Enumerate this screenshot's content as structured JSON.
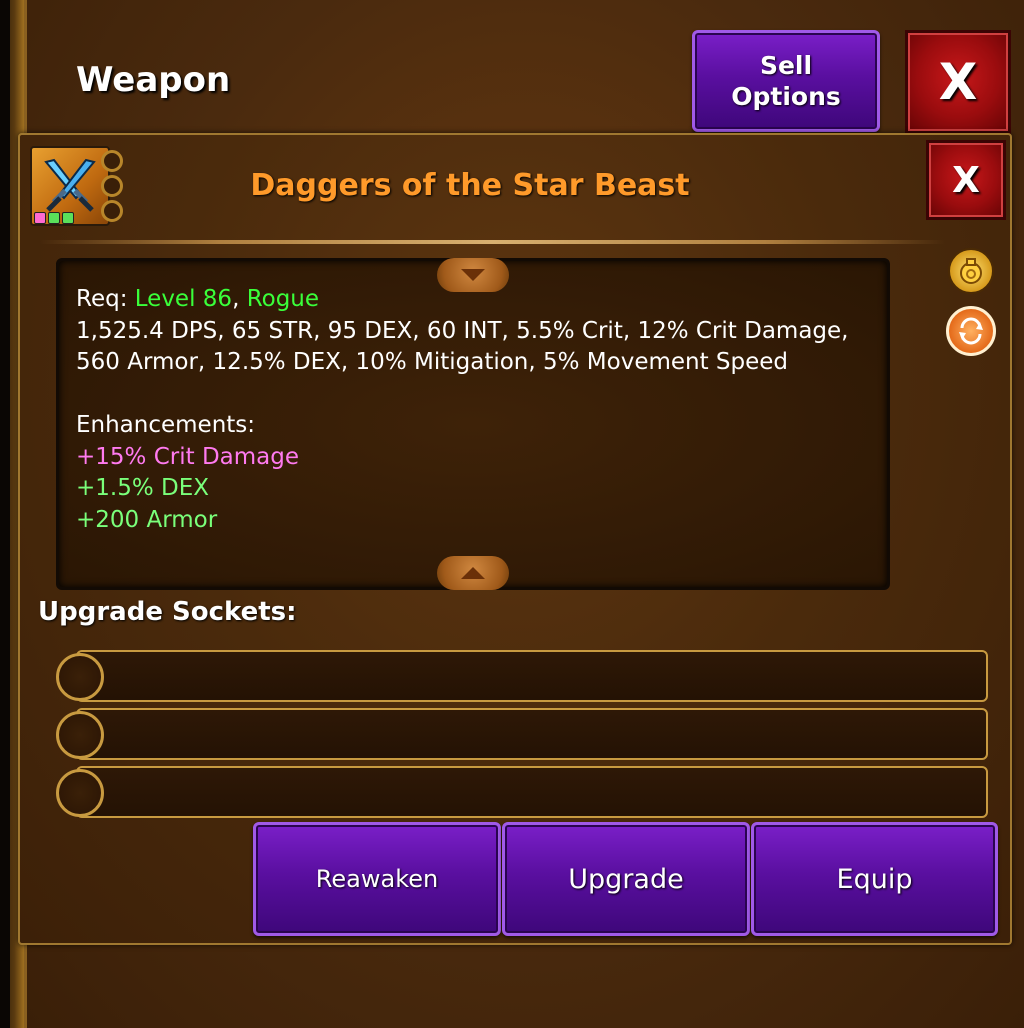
{
  "header": {
    "title": "Weapon",
    "sell_label_line1": "Sell",
    "sell_label_line2": "Options",
    "close_label": "X"
  },
  "item": {
    "name": "Daggers of the Star Beast",
    "close_label": "X",
    "icon": "crossed-daggers-icon",
    "gem_dot_colors": [
      "#ff6ad0",
      "#5ae05a",
      "#5ae05a"
    ],
    "req_label": "Req:",
    "req_level": "Level 86",
    "req_sep": ",",
    "req_class": "Rogue",
    "stats": "1,525.4 DPS, 65 STR, 95 DEX, 60 INT, 5.5% Crit, 12% Crit Damage, 560 Armor, 12.5% DEX, 10% Mitigation, 5% Movement Speed",
    "enhancements_label": "Enhancements:",
    "enhancements": [
      {
        "text": "+15% Crit Damage",
        "color": "#ff7af0"
      },
      {
        "text": "+1.5% DEX",
        "color": "#7aff7a"
      },
      {
        "text": "+200 Armor",
        "color": "#7aff7a"
      }
    ]
  },
  "side_icons": [
    "coin-bag-icon",
    "swap-icon"
  ],
  "sockets": {
    "label": "Upgrade Sockets:",
    "count": 3
  },
  "actions": {
    "reawaken": "Reawaken",
    "upgrade": "Upgrade",
    "equip": "Equip"
  },
  "colors": {
    "accent_purple": "#5a0fa0",
    "close_red": "#9a0c0e",
    "title_orange": "#ff9a2a",
    "req_green": "#3aff3a"
  }
}
